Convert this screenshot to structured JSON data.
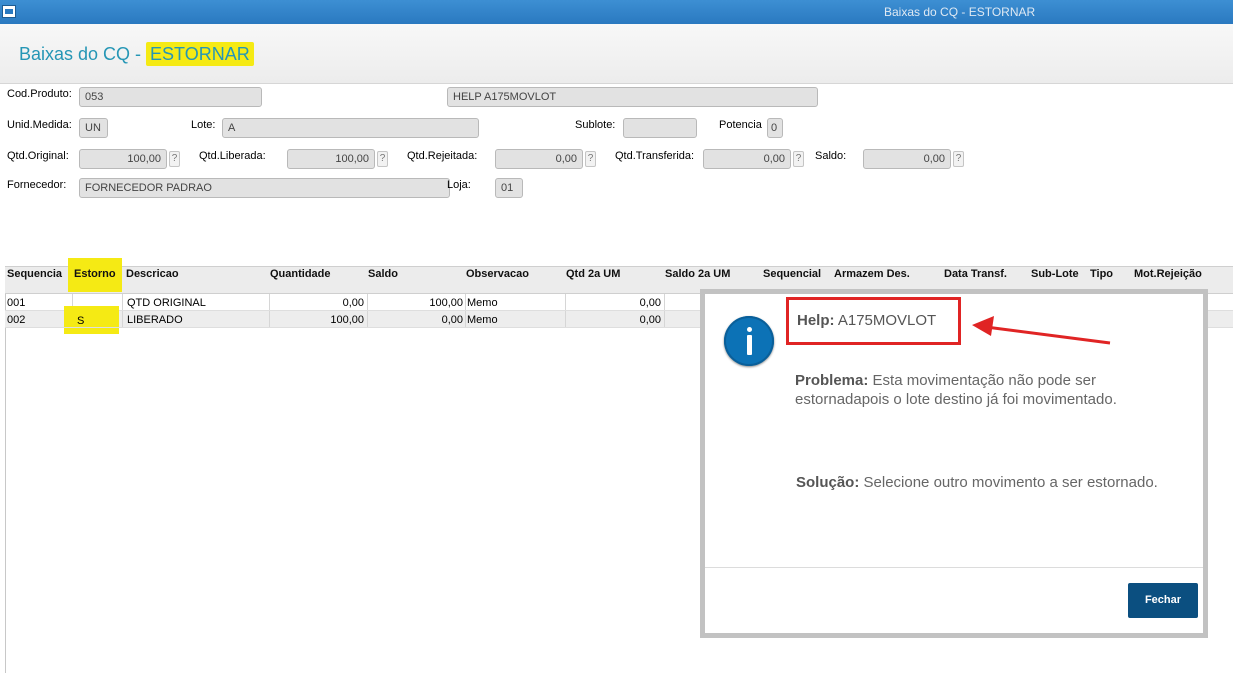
{
  "window": {
    "title": "Baixas do CQ - ESTORNAR"
  },
  "page": {
    "title_prefix": "Baixas do CQ - ",
    "title_highlight": "ESTORNAR"
  },
  "form": {
    "cod_produto": {
      "label": "Cod.Produto:",
      "value": "053",
      "desc": "HELP A175MOVLOT"
    },
    "unid_medida": {
      "label": "Unid.Medida:",
      "value": "UN"
    },
    "lote": {
      "label": "Lote:",
      "value": "A"
    },
    "sublote": {
      "label": "Sublote:",
      "value": ""
    },
    "potencia": {
      "label": "Potencia",
      "value": "0"
    },
    "qtd_original": {
      "label": "Qtd.Original:",
      "value": "100,00"
    },
    "qtd_liberada": {
      "label": "Qtd.Liberada:",
      "value": "100,00"
    },
    "qtd_rejeitada": {
      "label": "Qtd.Rejeitada:",
      "value": "0,00"
    },
    "qtd_transferida": {
      "label": "Qtd.Transferida:",
      "value": "0,00"
    },
    "saldo": {
      "label": "Saldo:",
      "value": "0,00"
    },
    "fornecedor": {
      "label": "Fornecedor:",
      "value": "FORNECEDOR PADRAO"
    },
    "loja": {
      "label": "Loja:",
      "value": "01"
    },
    "help_glyph": "?"
  },
  "grid": {
    "columns": [
      "Sequencia",
      "Estorno",
      "Descricao",
      "Quantidade",
      "Saldo",
      "Observacao",
      "Qtd 2a UM",
      "Saldo 2a UM",
      "Sequencial",
      "Armazem Des.",
      "Data Transf.",
      "Sub-Lote",
      "Tipo",
      "Mot.Rejeição"
    ],
    "rows": [
      {
        "sequencia": "001",
        "estorno": "",
        "descricao": "QTD ORIGINAL",
        "quantidade": "0,00",
        "saldo": "100,00",
        "observacao": "Memo",
        "qtd2um": "0,00"
      },
      {
        "sequencia": "002",
        "estorno": "S",
        "descricao": "LIBERADO",
        "quantidade": "100,00",
        "saldo": "0,00",
        "observacao": "Memo",
        "qtd2um": "0,00"
      }
    ]
  },
  "modal": {
    "help_label": "Help:",
    "help_code": "A175MOVLOT",
    "problem_label": "Problema:",
    "problem_line1": "Esta movimentação não pode ser",
    "problem_line2": "estornadapois o lote destino já foi movimentado.",
    "solution_label": "Solução:",
    "solution_text": "Selecione outro movimento a ser estornado.",
    "close_label": "Fechar"
  },
  "colors": {
    "title_blue": "#2596b5",
    "highlight": "#f5ea14",
    "annotation_red": "#e02424",
    "button_blue": "#0b4f80",
    "info_blue": "#0c72b6"
  },
  "icons": {
    "window": "app-window-icon",
    "info": "info-icon",
    "help": "question-icon",
    "annotation": "red-arrow-icon"
  }
}
